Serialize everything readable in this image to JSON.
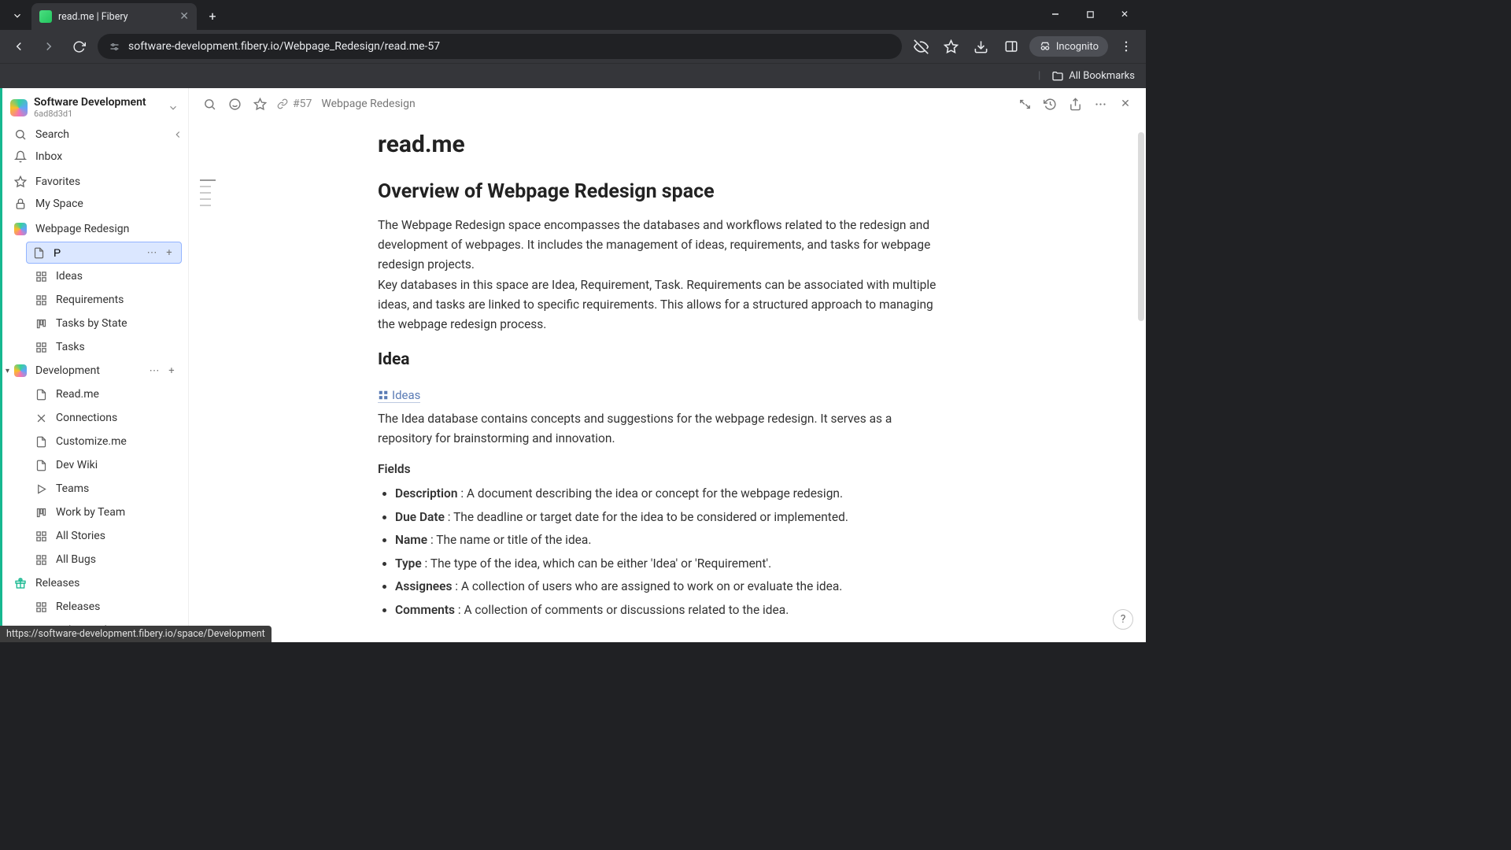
{
  "browser": {
    "tab_title": "read.me | Fibery",
    "url": "software-development.fibery.io/Webpage_Redesign/read.me-57",
    "incognito_label": "Incognito",
    "all_bookmarks": "All Bookmarks",
    "status_url": "https://software-development.fibery.io/space/Development"
  },
  "workspace": {
    "name": "Software Development",
    "id": "6ad8d3d1"
  },
  "sidebar": {
    "search": "Search",
    "inbox": "Inbox",
    "favorites": "Favorites",
    "myspace": "My Space",
    "spaces": [
      {
        "name": "Webpage Redesign",
        "items": [
          {
            "label": "P",
            "editing": true,
            "icon": "doc"
          },
          {
            "label": "Ideas",
            "icon": "grid"
          },
          {
            "label": "Requirements",
            "icon": "grid"
          },
          {
            "label": "Tasks by State",
            "icon": "board"
          },
          {
            "label": "Tasks",
            "icon": "grid"
          }
        ]
      },
      {
        "name": "Development",
        "hovered": true,
        "items": [
          {
            "label": "Read.me",
            "icon": "doc"
          },
          {
            "label": "Connections",
            "icon": "connect"
          },
          {
            "label": "Customize.me",
            "icon": "doc"
          },
          {
            "label": "Dev Wiki",
            "icon": "doc"
          },
          {
            "label": "Teams",
            "icon": "play"
          },
          {
            "label": "Work by Team",
            "icon": "board"
          },
          {
            "label": "All Stories",
            "icon": "grid"
          },
          {
            "label": "All Bugs",
            "icon": "grid"
          }
        ]
      },
      {
        "name": "Releases",
        "items": [
          {
            "label": "Releases",
            "icon": "grid"
          },
          {
            "label": "Release Planning",
            "icon": "board"
          }
        ]
      }
    ]
  },
  "doc_header": {
    "entity_id": "#57",
    "breadcrumb": "Webpage Redesign"
  },
  "doc": {
    "title": "read.me",
    "overview_heading": "Overview of Webpage Redesign space",
    "overview_p1": "The Webpage Redesign space encompasses the databases and workflows related to the redesign and development of webpages. It includes the management of ideas, requirements, and tasks for webpage redesign projects.",
    "overview_p2": "Key databases in this space are Idea, Requirement, Task. Requirements can be associated with multiple ideas, and tasks are linked to specific requirements. This allows for a structured approach to managing the webpage redesign process.",
    "idea_heading": "Idea",
    "ideas_link": "Ideas",
    "idea_desc": "The Idea database contains concepts and suggestions for the webpage redesign. It serves as a repository for brainstorming and innovation.",
    "fields_label": "Fields",
    "fields": [
      {
        "name": "Description",
        "desc": " : A document describing the idea or concept for the webpage redesign."
      },
      {
        "name": "Due Date",
        "desc": " : The deadline or target date for the idea to be considered or implemented."
      },
      {
        "name": "Name",
        "desc": " : The name or title of the idea."
      },
      {
        "name": "Type",
        "desc": " : The type of the idea, which can be either 'Idea' or 'Requirement'."
      },
      {
        "name": "Assignees",
        "desc": " : A collection of users who are assigned to work on or evaluate the idea."
      },
      {
        "name": "Comments",
        "desc": " : A collection of comments or discussions related to the idea."
      }
    ]
  },
  "help": "?"
}
